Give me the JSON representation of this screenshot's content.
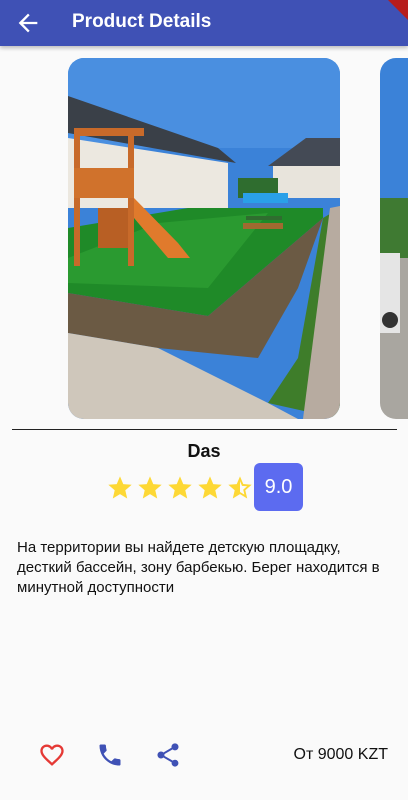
{
  "appbar": {
    "title": "Product Details"
  },
  "product": {
    "name": "Das",
    "rating": 9.0,
    "rating_label": "9.0",
    "stars_filled": 4.5,
    "stars_total": 5,
    "description": "На территории вы найдете детскую площадку, десткий бассейн, зону барбекью. Берег находится в минутной доступности",
    "price_label": "От 9000 KZT"
  },
  "colors": {
    "appbar": "#3f51b5",
    "star": "#fdd835",
    "badge": "#5c6bf0",
    "heart": "#e53935",
    "phone": "#3f51b5",
    "share": "#3f51b5"
  },
  "actions": [
    {
      "icon": "heart-outline-icon"
    },
    {
      "icon": "phone-icon"
    },
    {
      "icon": "share-icon"
    }
  ]
}
